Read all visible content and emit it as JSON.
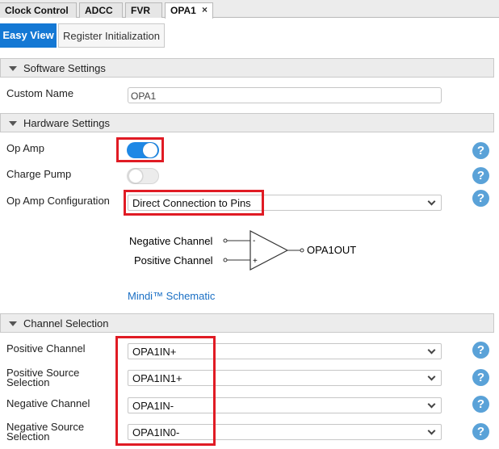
{
  "doc_tabs": [
    {
      "label": "Clock Control"
    },
    {
      "label": "ADCC"
    },
    {
      "label": "FVR"
    },
    {
      "label": "OPA1",
      "close": "×"
    }
  ],
  "view_tabs": {
    "easy": "Easy View",
    "register": "Register Initialization"
  },
  "software_settings": {
    "title": "Software Settings",
    "custom_name_label": "Custom Name",
    "custom_name_value": "OPA1"
  },
  "hardware_settings": {
    "title": "Hardware Settings",
    "op_amp_label": "Op Amp",
    "op_amp_enabled": true,
    "charge_pump_label": "Charge Pump",
    "charge_pump_enabled": false,
    "config_label": "Op Amp Configuration",
    "config_value": "Direct Connection to Pins"
  },
  "diagram": {
    "negative_channel": "Negative Channel",
    "positive_channel": "Positive Channel",
    "minus_sign": "-",
    "plus_sign": "+",
    "output": "OPA1OUT"
  },
  "schematic_link": "Mindi™ Schematic",
  "channel_selection": {
    "title": "Channel Selection",
    "positive_channel_label": "Positive Channel",
    "positive_channel_value": "OPA1IN+",
    "positive_source_label_1": "Positive Source",
    "positive_source_label_2": "Selection",
    "positive_source_value": "OPA1IN1+",
    "negative_channel_label": "Negative Channel",
    "negative_channel_value": "OPA1IN-",
    "negative_source_label_1": "Negative Source",
    "negative_source_label_2": "Selection",
    "negative_source_value": "OPA1IN0-"
  },
  "help_symbol": "?",
  "colors": {
    "accent": "#1478d4",
    "toggle_on": "#1e88e5",
    "highlight": "#e01b24",
    "help": "#5aa2d8"
  }
}
